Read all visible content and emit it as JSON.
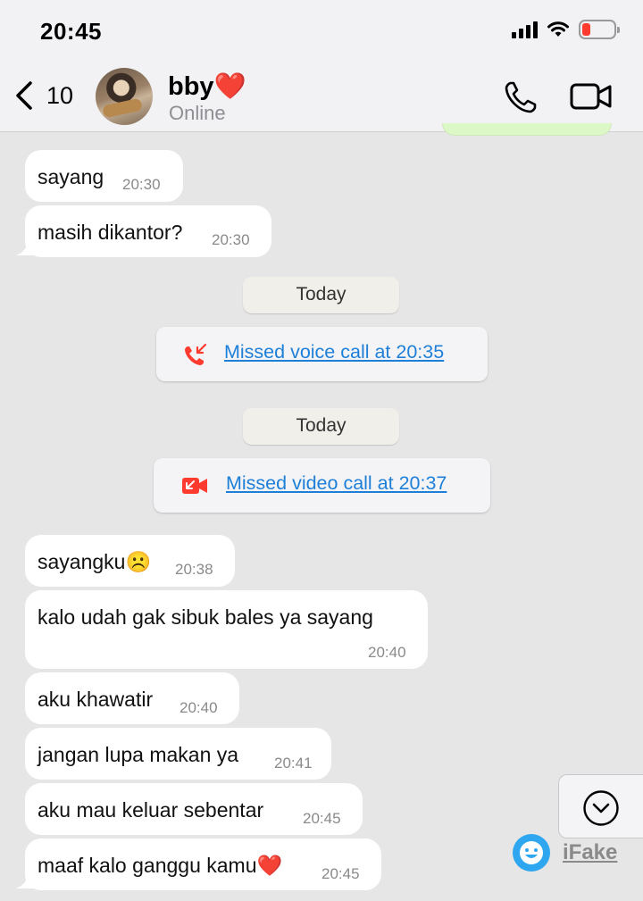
{
  "status_bar": {
    "time": "20:45"
  },
  "header": {
    "back_count": "10",
    "contact_name": "bby",
    "name_emoji": "❤️",
    "contact_status": "Online"
  },
  "messages": [
    {
      "text": "sayang",
      "time": "20:30"
    },
    {
      "text": "masih dikantor?",
      "time": "20:30"
    },
    {
      "text": "sayangku☹️",
      "time": "20:38"
    },
    {
      "text": "kalo udah gak sibuk bales ya sayang",
      "time": "20:40"
    },
    {
      "text": "aku khawatir",
      "time": "20:40"
    },
    {
      "text": "jangan lupa makan ya",
      "time": "20:41"
    },
    {
      "text": "aku mau keluar sebentar",
      "time": "20:45"
    },
    {
      "text": "maaf kalo ganggu kamu❤️",
      "time": "20:45"
    }
  ],
  "system": {
    "date_label_1": "Today",
    "missed_voice": "Missed voice call at 20:35",
    "date_label_2": "Today",
    "missed_video": "Missed video call at 20:37"
  },
  "watermark": {
    "brand": "iFake"
  },
  "colors": {
    "background": "#e6e6e6",
    "bubble": "#ffffff",
    "link": "#1e7fd8",
    "missed": "#ff3b30",
    "battery_low": "#ff3b30"
  }
}
